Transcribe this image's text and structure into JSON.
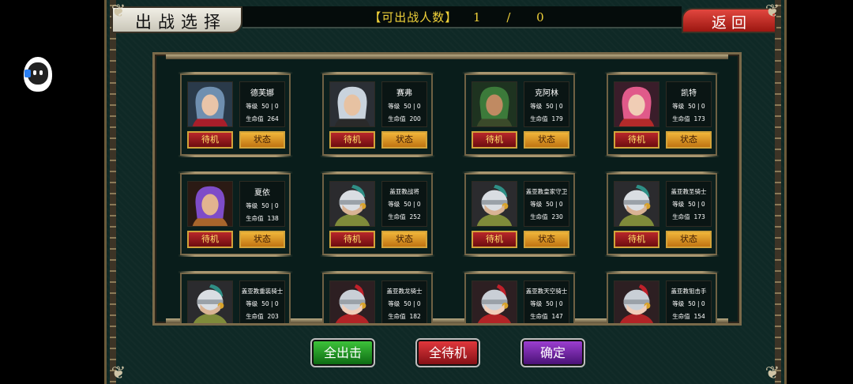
{
  "header": {
    "title": "出战选择",
    "deploy_label": "【可出战人数】",
    "deploy_count": "1 / 0",
    "back_label": "返回"
  },
  "card_buttons": {
    "standby": "待机",
    "status": "状态"
  },
  "stat_labels": {
    "level": "等级",
    "hp": "生命值"
  },
  "characters": [
    {
      "name": "德芙娜",
      "level": "50 | 0",
      "hp": "264",
      "portrait": "blue-haired-female"
    },
    {
      "name": "赛弗",
      "level": "50 | 0",
      "hp": "200",
      "portrait": "silver-haired-male"
    },
    {
      "name": "克阿林",
      "level": "50 | 0",
      "hp": "179",
      "portrait": "bearded-male"
    },
    {
      "name": "凯特",
      "level": "50 | 0",
      "hp": "173",
      "portrait": "pink-haired-female"
    },
    {
      "name": "夏依",
      "level": "50 | 0",
      "hp": "138",
      "portrait": "purple-hooded-female"
    },
    {
      "name": "盖亚教战将",
      "level": "50 | 0",
      "hp": "252",
      "portrait": "helmeted-soldier"
    },
    {
      "name": "盖亚教皇家守卫",
      "level": "50 | 0",
      "hp": "230",
      "portrait": "helmeted-soldier"
    },
    {
      "name": "盖亚教圣骑士",
      "level": "50 | 0",
      "hp": "173",
      "portrait": "helmeted-soldier"
    },
    {
      "name": "盖亚教重装骑士",
      "level": "50 | 0",
      "hp": "203",
      "portrait": "helmeted-soldier"
    },
    {
      "name": "盖亚教龙骑士",
      "level": "50 | 0",
      "hp": "182",
      "portrait": "red-helmet-female"
    },
    {
      "name": "盖亚教天空骑士",
      "level": "50 | 0",
      "hp": "147",
      "portrait": "red-helmet-female"
    },
    {
      "name": "盖亚教狙击手",
      "level": "50 | 0",
      "hp": "154",
      "portrait": "red-helmet-female"
    }
  ],
  "footer": {
    "all_attack": "全出击",
    "all_standby": "全待机",
    "confirm": "确定"
  },
  "colors": {
    "background": "#0f2926",
    "count_text": "#f1d23a",
    "standby_button": "#b8272a",
    "status_button": "#f0b53a",
    "all_attack": "#2a9a2a",
    "all_standby": "#c01e24",
    "confirm": "#7a2aa8"
  }
}
